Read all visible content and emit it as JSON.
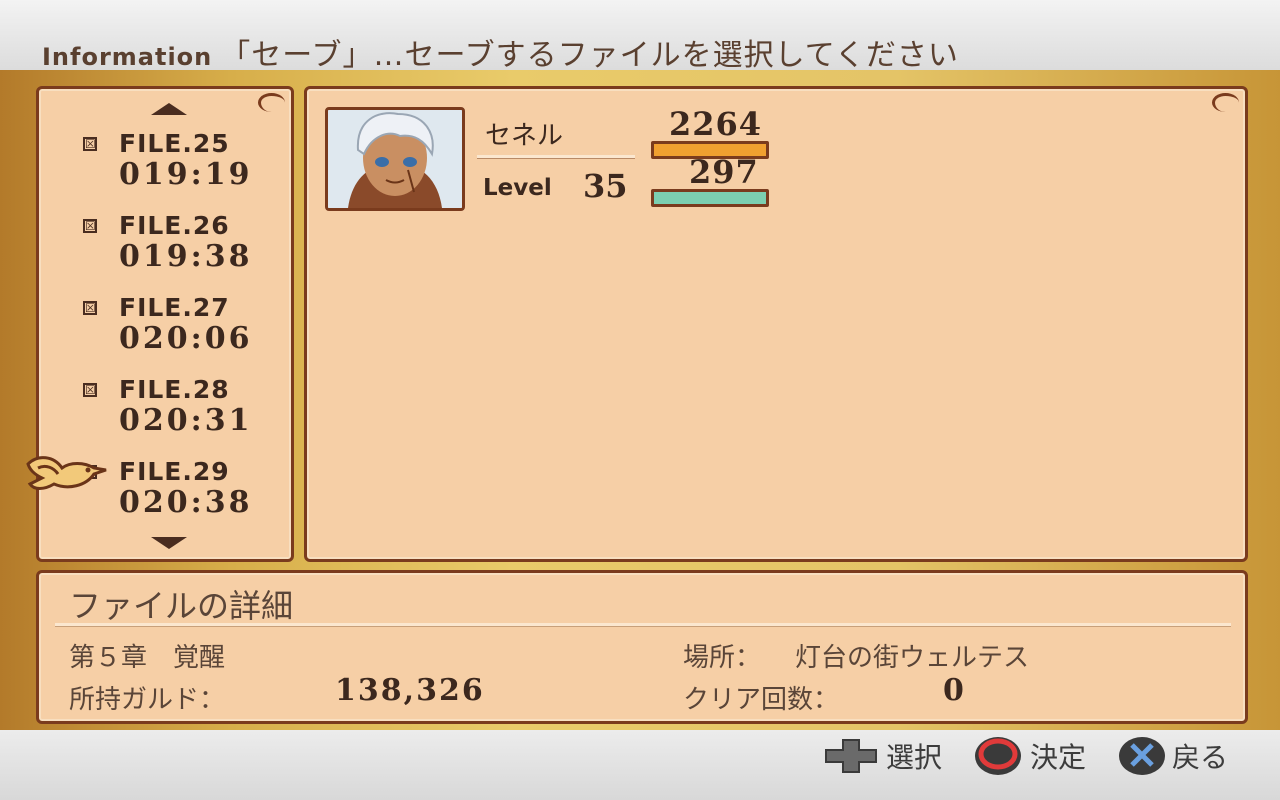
{
  "header": {
    "label": "Information",
    "message": "「セーブ」…セーブするファイルを選択してください"
  },
  "files": [
    {
      "name": "FILE.25",
      "time": "019:19",
      "mark": "☒"
    },
    {
      "name": "FILE.26",
      "time": "019:38",
      "mark": "☒"
    },
    {
      "name": "FILE.27",
      "time": "020:06",
      "mark": "☒"
    },
    {
      "name": "FILE.28",
      "time": "020:31",
      "mark": "☒"
    },
    {
      "name": "FILE.29",
      "time": "020:38",
      "mark": "☒"
    }
  ],
  "character": {
    "name": "セネル",
    "level_label": "Level",
    "level": "35",
    "hp": "2264",
    "tp": "297",
    "portrait_icon": "character-portrait"
  },
  "details": {
    "title": "ファイルの詳細",
    "chapter": "第５章　覚醒",
    "gald_label": "所持ガルド：",
    "gald": "138,326",
    "location_label": "場所：",
    "location": "灯台の街ウェルテス",
    "clear_label": "クリア回数：",
    "clear_count": "0"
  },
  "controls": {
    "select": "選択",
    "confirm": "決定",
    "back": "戻る"
  },
  "colors": {
    "panel": "#f6cfa6",
    "border": "#7a3b1d",
    "hp_bar": "#f0a030",
    "tp_bar": "#7ccfb0"
  }
}
